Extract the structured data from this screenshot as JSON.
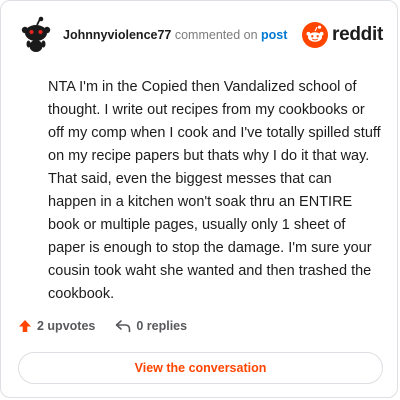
{
  "header": {
    "username": "Johnnyviolence77",
    "action": "commented on",
    "post_link": "post",
    "brand": "reddit"
  },
  "comment": {
    "text": "NTA I'm in the Copied then Vandalized school of thought. I write out recipes from my cookbooks or off my comp when I cook and I've totally spilled stuff on my recipe papers but thats why I do it that way. That said, even the biggest messes that can happen in a kitchen won't soak thru an ENTIRE book or multiple pages, usually only 1 sheet of paper is enough to stop the damage. I'm sure your cousin took waht she wanted and then trashed the cookbook."
  },
  "footer": {
    "upvotes": "2 upvotes",
    "replies": "0 replies",
    "upvote_icon": "upvote-arrow-icon",
    "reply_icon": "reply-icon"
  },
  "cta": {
    "label": "View the conversation"
  },
  "colors": {
    "brand": "#ff4500",
    "link": "#0079d3",
    "text": "#1c1c1c",
    "muted": "#7c7c7c"
  }
}
